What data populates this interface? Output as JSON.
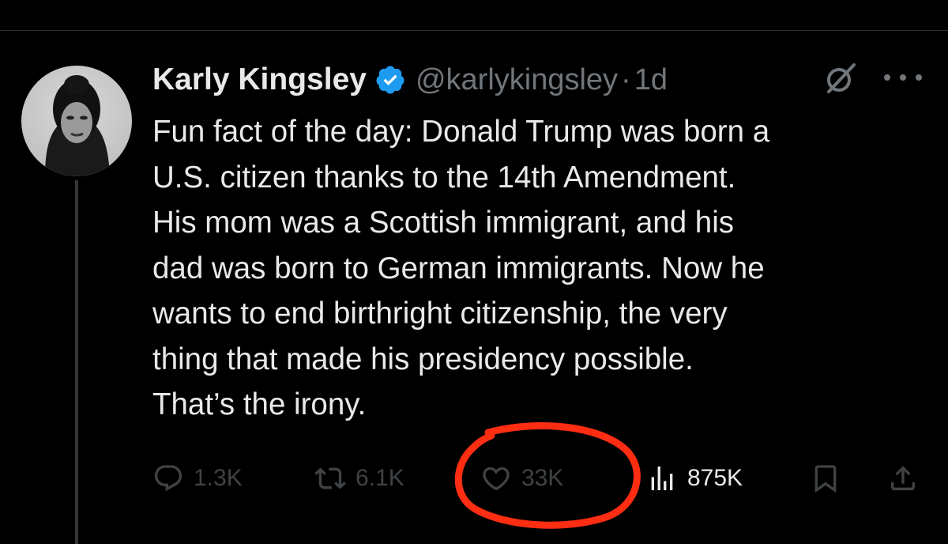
{
  "author": {
    "name": "Karly Kingsley",
    "handle": "@karlykingsley",
    "separator": "·",
    "time": "1d",
    "verified": true,
    "verified_color": "#1d9bf0"
  },
  "tweet": {
    "lines": [
      "Fun fact of the day: Donald Trump was born a",
      "U.S. citizen thanks to the 14th Amendment.",
      "His mom was a Scottish immigrant, and his",
      "dad was born to German immigrants. Now he",
      "wants to end birthright citizenship, the very",
      "thing that made his presidency possible.",
      "That’s the irony."
    ]
  },
  "actions": {
    "replies": "1.3K",
    "reposts": "6.1K",
    "likes": "33K",
    "views": "875K"
  },
  "icons": {
    "reply": "reply-icon",
    "repost": "repost-icon",
    "like": "heart-icon",
    "views": "views-icon",
    "bookmark": "bookmark-icon",
    "share": "share-icon",
    "grok": "grok-icon",
    "more": "more-icon"
  },
  "annotation": {
    "color": "#ff2d12"
  },
  "colors": {
    "background": "#000000",
    "text": "#e7e9ea",
    "muted": "#71767b"
  }
}
